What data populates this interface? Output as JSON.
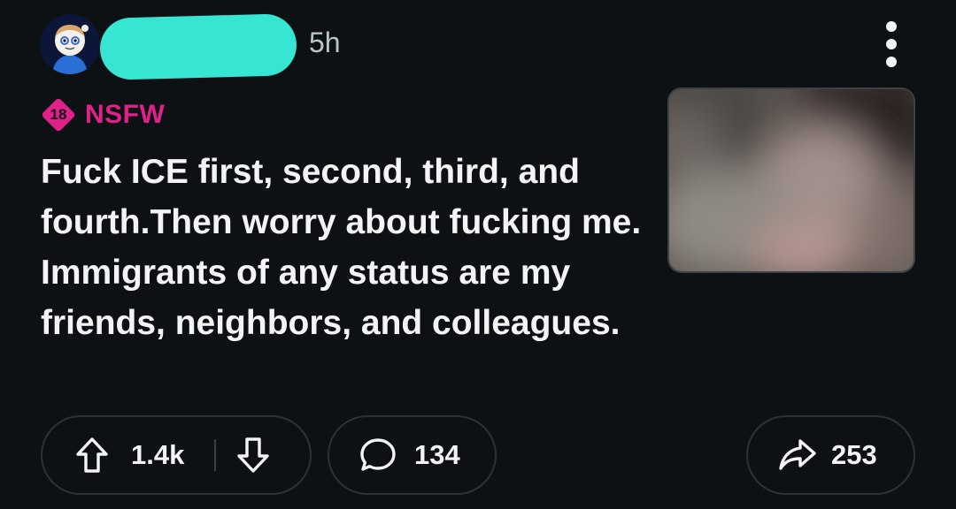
{
  "header": {
    "time": "5h",
    "menu_icon": "more-vertical-icon",
    "avatar_icon": "snoo-avatar-icon",
    "redaction_color": "#37e6d2"
  },
  "nsfw": {
    "badge_number": "18",
    "label": "NSFW",
    "color": "#e0218a"
  },
  "post": {
    "title": "Fuck ICE first, second, third, and fourth.Then worry about fucking me. Immigrants of any status are my friends, neighbors, and colleagues."
  },
  "actions": {
    "upvote_icon": "upvote-arrow-icon",
    "vote_count": "1.4k",
    "downvote_icon": "downvote-arrow-icon",
    "comment_icon": "comment-bubble-icon",
    "comment_count": "134",
    "share_icon": "share-arrow-icon",
    "share_count": "253"
  }
}
